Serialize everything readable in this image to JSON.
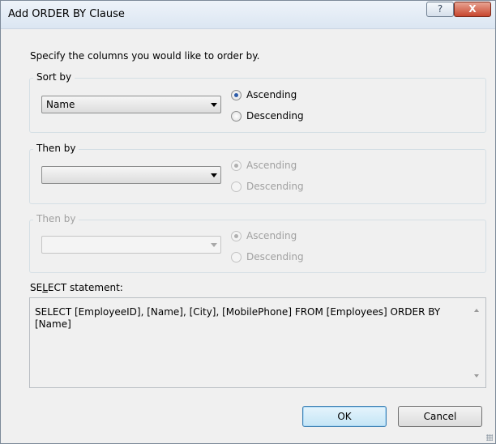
{
  "window": {
    "title": "Add ORDER BY Clause",
    "help_label": "?",
    "close_label": "X"
  },
  "instruction": "Specify the columns you would like to order by.",
  "groups": [
    {
      "label": "Sort by",
      "field_value": "Name",
      "enabled": true,
      "ascending_label": "Ascending",
      "descending_label": "Descending",
      "selected": "Ascending"
    },
    {
      "label": "Then by",
      "field_value": "",
      "enabled": true,
      "ascending_label": "Ascending",
      "descending_label": "Descending",
      "selected": "Ascending"
    },
    {
      "label": "Then by",
      "field_value": "",
      "enabled": false,
      "ascending_label": "Ascending",
      "descending_label": "Descending",
      "selected": "Ascending"
    }
  ],
  "select_statement": {
    "label_before": "SE",
    "label_underlined": "L",
    "label_after": "ECT statement:",
    "text": "SELECT [EmployeeID], [Name], [City], [MobilePhone] FROM [Employees] ORDER BY [Name]"
  },
  "buttons": {
    "ok_label": "OK",
    "cancel_label": "Cancel"
  }
}
